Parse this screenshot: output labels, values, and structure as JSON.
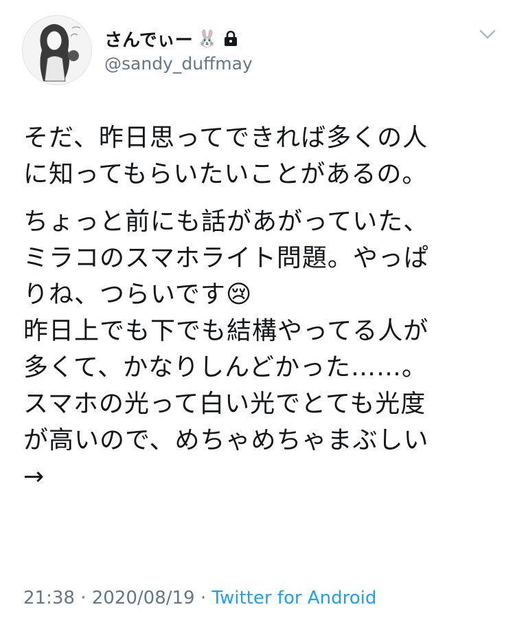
{
  "user": {
    "display_name": "さんでぃー",
    "name_emoji": "🐰",
    "handle": "@sandy_duffmay",
    "protected": true
  },
  "tweet": {
    "paragraphs": [
      "そだ、昨日思ってできれば多くの人\nに知ってもらいたいことがあるの。",
      "ちょっと前にも話があがっていた、\nミラコのスマホライト問題。やっぱ\nりね、つらいです😢\n昨日上でも下でも結構やってる人が\n多くて、かなりしんどかった……。\nスマホの光って白い光でとても光度\nが高いので、めちゃめちゃまぶしい\n→"
    ]
  },
  "meta": {
    "time": "21:38",
    "separator": " · ",
    "date": "2020/08/19",
    "source": "Twitter for Android"
  },
  "colors": {
    "text": "#14171a",
    "secondary": "#657786",
    "link": "#1da1f2"
  }
}
